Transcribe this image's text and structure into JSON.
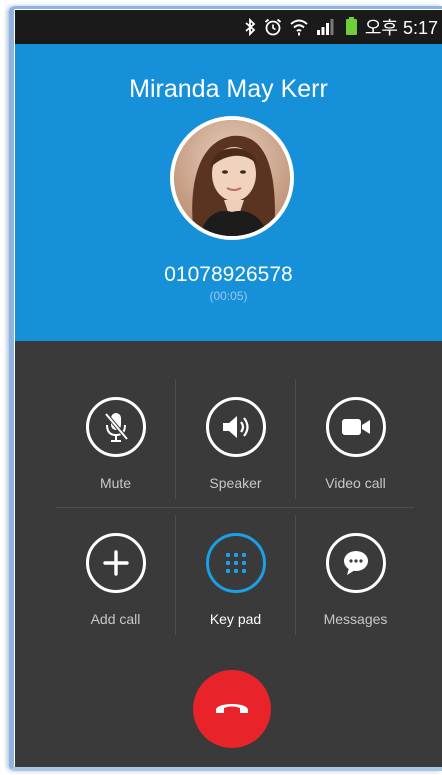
{
  "status_bar": {
    "time": "오후 5:17",
    "icons": [
      "bluetooth-icon",
      "alarm-icon",
      "wifi-icon",
      "signal-icon",
      "battery-icon"
    ]
  },
  "caller": {
    "name": "Miranda May Kerr",
    "number": "01078926578",
    "duration": "(00:05)"
  },
  "controls": [
    {
      "id": "mute",
      "label": "Mute",
      "icon": "mic-muted-icon",
      "active": false
    },
    {
      "id": "speaker",
      "label": "Speaker",
      "icon": "speaker-icon",
      "active": false
    },
    {
      "id": "video",
      "label": "Video call",
      "icon": "video-camera-icon",
      "active": false
    },
    {
      "id": "add",
      "label": "Add call",
      "icon": "plus-icon",
      "active": false
    },
    {
      "id": "keypad",
      "label": "Key pad",
      "icon": "keypad-icon",
      "active": true
    },
    {
      "id": "messages",
      "label": "Messages",
      "icon": "message-bubble-icon",
      "active": false
    }
  ],
  "end_call": {
    "icon": "hang-up-icon"
  },
  "colors": {
    "header_blue": "#1690d8",
    "background": "#3a3a3a",
    "accent_active": "#1ba0e8",
    "end_call_red": "#e8232a",
    "battery_green": "#6ecf3a"
  }
}
